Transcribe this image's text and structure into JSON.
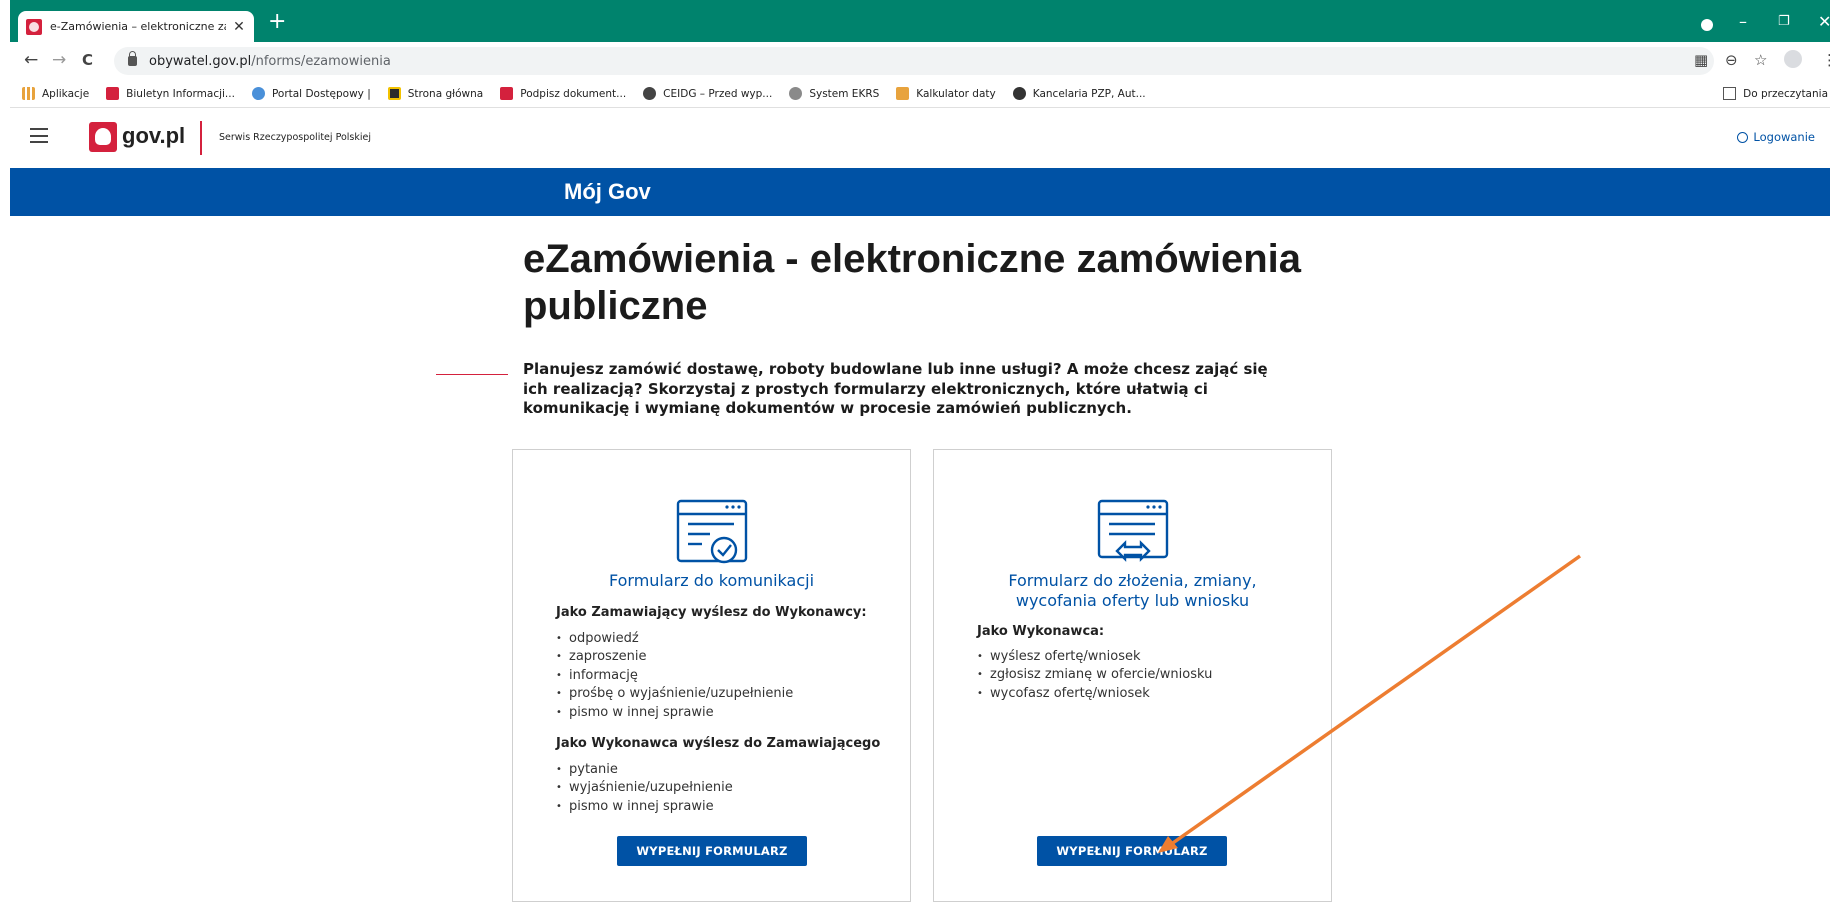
{
  "browser": {
    "tab_title": "e-Zamówienia – elektroniczne za",
    "tab_close": "✕",
    "new_tab": "+",
    "url_host": "obywatel.gov.pl",
    "url_path": "/nforms/ezamowienia",
    "nav_back": "←",
    "nav_forward": "→",
    "nav_reload": "C",
    "win_minimize": "–",
    "win_restore": "❐",
    "win_close": "✕",
    "colors": {
      "tabbar": "#00836d"
    }
  },
  "bookmarks": [
    {
      "label": "Aplikacje",
      "icon": "apps-grid-icon",
      "color": "#e8a33d"
    },
    {
      "label": "Biuletyn Informacji...",
      "icon": "bip-icon",
      "color": "#d4213d"
    },
    {
      "label": "Portal Dostępowy |",
      "icon": "portal-icon",
      "color": "#4a90d9"
    },
    {
      "label": "Strona główna",
      "icon": "home-site-icon",
      "color": "#2b2b2b"
    },
    {
      "label": "Podpisz dokument...",
      "icon": "sign-doc-icon",
      "color": "#d4213d"
    },
    {
      "label": "CEIDG – Przed wyp...",
      "icon": "globe-icon",
      "color": "#444444"
    },
    {
      "label": "System EKRS",
      "icon": "ekrs-icon",
      "color": "#8a8a8a"
    },
    {
      "label": "Kalkulator daty",
      "icon": "calendar-icon",
      "color": "#e8a33d"
    },
    {
      "label": "Kancelaria PZP, Aut...",
      "icon": "kancelaria-icon",
      "color": "#333333"
    }
  ],
  "bookmarks_right": "Do przeczytania",
  "site": {
    "logo": "gov.pl",
    "subtitle": "Serwis Rzeczypospolitej Polskiej",
    "login": "Logowanie",
    "band_title": "Mój Gov",
    "brand_blue": "#0052a5",
    "brand_red": "#d4213d"
  },
  "main": {
    "title": "eZamówienia - elektroniczne zamówienia publiczne",
    "lead": "Planujesz zamówić dostawę, roboty budowlane lub inne usługi? A może chcesz zająć się ich realizacją? Skorzystaj z prostych formularzy elektronicznych, które ułatwią ci komunikację i wymianę dokumentów w procesie zamówień publicznych."
  },
  "cards": [
    {
      "title": "Formularz do komunikacji",
      "sections": [
        {
          "label": "Jako Zamawiający wyślesz do Wykonawcy:",
          "items": [
            "odpowiedź",
            "zaproszenie",
            "informację",
            "prośbę o wyjaśnienie/uzupełnienie",
            "pismo w innej sprawie"
          ]
        },
        {
          "label": "Jako Wykonawca wyślesz do Zamawiającego",
          "items": [
            "pytanie",
            "wyjaśnienie/uzupełnienie",
            "pismo w innej sprawie"
          ]
        }
      ],
      "button": "WYPEŁNIJ FORMULARZ"
    },
    {
      "title_line1": "Formularz do złożenia, zmiany,",
      "title_line2": "wycofania oferty lub wniosku",
      "sections": [
        {
          "label": "Jako Wykonawca:",
          "items": [
            "wyślesz ofertę/wniosek",
            "zgłosisz zmianę w ofercie/wniosku",
            "wycofasz ofertę/wniosek"
          ]
        }
      ],
      "button": "WYPEŁNIJ FORMULARZ"
    }
  ],
  "annotation": {
    "arrow_color": "#ed7d31"
  }
}
